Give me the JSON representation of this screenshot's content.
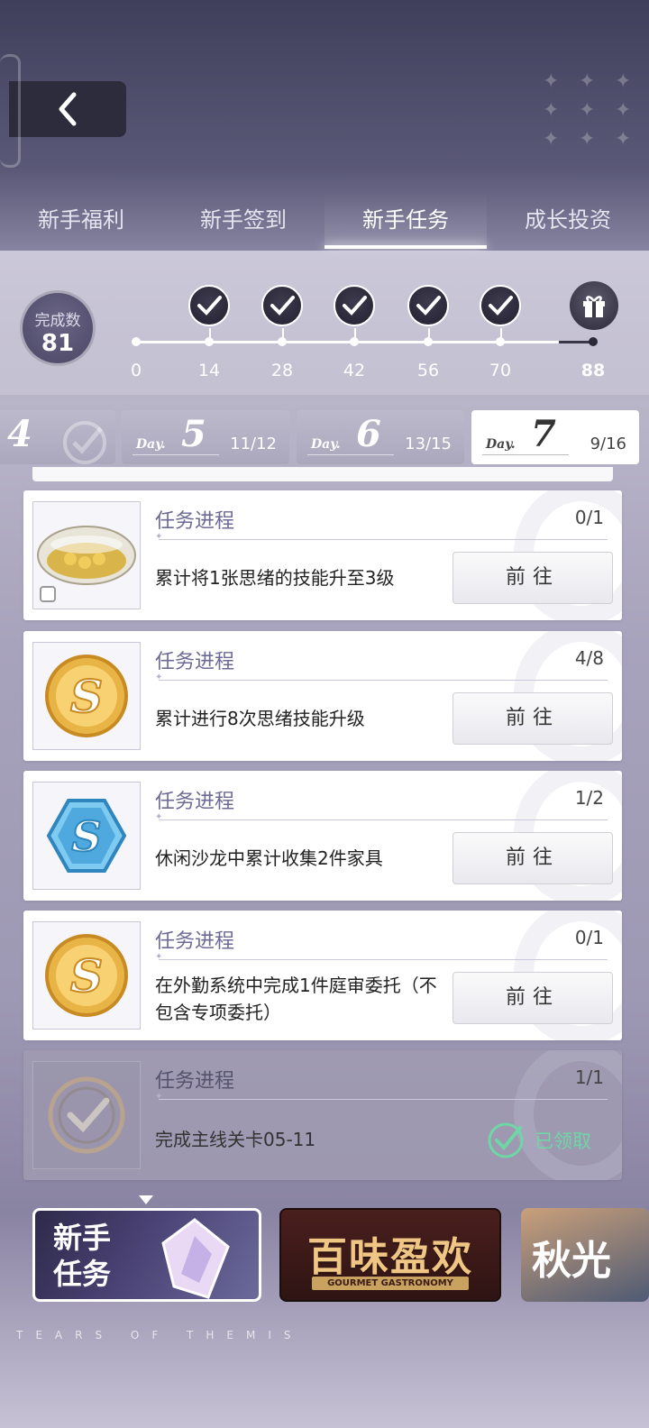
{
  "tabs": [
    {
      "label": "新手福利"
    },
    {
      "label": "新手签到"
    },
    {
      "label": "新手任务"
    },
    {
      "label": "成长投资"
    }
  ],
  "progress": {
    "count_label": "完成数",
    "count_value": "81",
    "ticks": [
      "0",
      "14",
      "28",
      "42",
      "56",
      "70",
      "88"
    ]
  },
  "days": [
    {
      "prefix": "",
      "num": "4",
      "progress": ""
    },
    {
      "prefix": "Day.",
      "num": "5",
      "progress": "11/12"
    },
    {
      "prefix": "Day.",
      "num": "6",
      "progress": "13/15"
    },
    {
      "prefix": "Day.",
      "num": "7",
      "progress": "9/16"
    }
  ],
  "tasks": [
    {
      "title": "任务进程",
      "count": "0/1",
      "desc": "累计将1张思绪的技能升至3级",
      "action": "前往",
      "icon": "bowl-item-icon"
    },
    {
      "title": "任务进程",
      "count": "4/8",
      "desc": "累计进行8次思绪技能升级",
      "action": "前往",
      "icon": "gold-coin-icon"
    },
    {
      "title": "任务进程",
      "count": "1/2",
      "desc": "休闲沙龙中累计收集2件家具",
      "action": "前往",
      "icon": "blue-crystal-icon"
    },
    {
      "title": "任务进程",
      "count": "0/1",
      "desc": "在外勤系统中完成1件庭审委托（不包含专项委托）",
      "action": "前往",
      "icon": "gold-coin-icon"
    },
    {
      "title": "任务进程",
      "count": "1/1",
      "desc": "完成主线关卡05-11",
      "action": "已领取",
      "icon": "claimed-medal-icon"
    }
  ],
  "banners": [
    {
      "title": "新手\n任务"
    },
    {
      "title": "百味盈欢",
      "sub": "GOURMET GASTRONOMY"
    },
    {
      "title": "秋光"
    }
  ],
  "footer": {
    "brand": "TEARS OF THEMIS"
  }
}
